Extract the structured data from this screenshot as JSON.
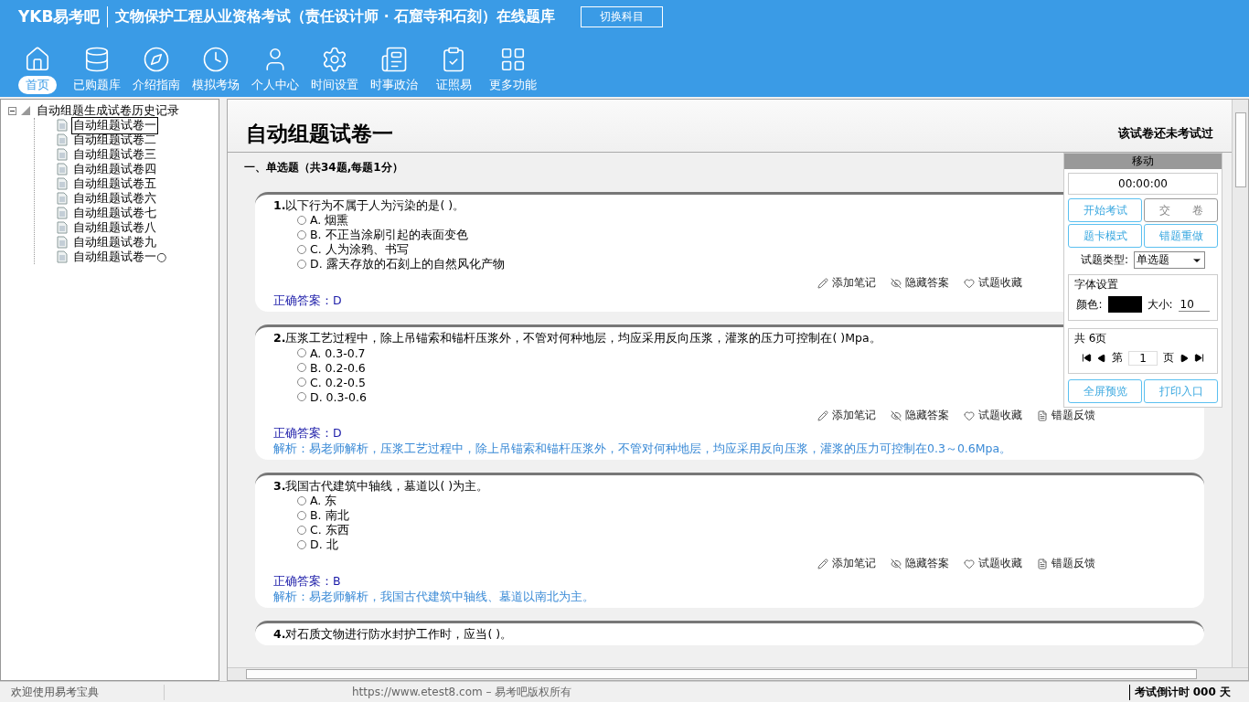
{
  "header": {
    "logo": "YKB易考吧",
    "title": "文物保护工程从业资格考试（责任设计师 · 石窟寺和石刻）在线题库",
    "switch_button": "切换科目"
  },
  "nav": [
    {
      "label": "首页",
      "selected": true,
      "kind": "home"
    },
    {
      "label": "已购题库",
      "selected": false,
      "kind": "bank"
    },
    {
      "label": "介绍指南",
      "selected": false,
      "kind": "guide"
    },
    {
      "label": "模拟考场",
      "selected": false,
      "kind": "exam"
    },
    {
      "label": "个人中心",
      "selected": false,
      "kind": "user"
    },
    {
      "label": "时间设置",
      "selected": false,
      "kind": "settings"
    },
    {
      "label": "时事政治",
      "selected": false,
      "kind": "news"
    },
    {
      "label": "证照易",
      "selected": false,
      "kind": "cert"
    },
    {
      "label": "更多功能",
      "selected": false,
      "kind": "more"
    }
  ],
  "tree": {
    "label": "自动组题生成试卷历史记录",
    "expanded": true,
    "children": [
      {
        "label": "自动组题试卷一",
        "selected": true
      },
      {
        "label": "自动组题试卷二",
        "selected": false
      },
      {
        "label": "自动组题试卷三",
        "selected": false
      },
      {
        "label": "自动组题试卷四",
        "selected": false
      },
      {
        "label": "自动组题试卷五",
        "selected": false
      },
      {
        "label": "自动组题试卷六",
        "selected": false
      },
      {
        "label": "自动组题试卷七",
        "selected": false
      },
      {
        "label": "自动组题试卷八",
        "selected": false
      },
      {
        "label": "自动组题试卷九",
        "selected": false
      },
      {
        "label": "自动组题试卷一○",
        "selected": false
      }
    ]
  },
  "paper": {
    "title": "自动组题试卷一",
    "status": "该试卷还未考试过",
    "section": "一、单选题（共34题,每题1分）",
    "questions": [
      {
        "number": "1.",
        "text": "以下行为不属于人为污染的是( )。",
        "options": [
          {
            "letter": "A.",
            "text": "烟熏",
            "selected": false
          },
          {
            "letter": "B.",
            "text": "不正当涂刷引起的表面变色",
            "selected": false
          },
          {
            "letter": "C.",
            "text": "人为涂鸦、书写",
            "selected": false
          },
          {
            "letter": "D.",
            "text": "露天存放的石刻上的自然风化产物",
            "selected": false
          }
        ],
        "actions": [
          "添加笔记",
          "隐藏答案",
          "试题收藏"
        ],
        "answer_label": "正确答案：",
        "answer": "D"
      },
      {
        "number": "2.",
        "text": "压浆工艺过程中，除上吊锚索和锚杆压浆外，不管对何种地层，均应采用反向压浆，灌浆的压力可控制在( )Mpa。",
        "options": [
          {
            "letter": "A.",
            "text": "0.3-0.7",
            "selected": false
          },
          {
            "letter": "B.",
            "text": "0.2-0.6",
            "selected": false
          },
          {
            "letter": "C.",
            "text": "0.2-0.5",
            "selected": false
          },
          {
            "letter": "D.",
            "text": "0.3-0.6",
            "selected": false
          }
        ],
        "actions": [
          "添加笔记",
          "隐藏答案",
          "试题收藏",
          "错题反馈"
        ],
        "answer_label": "正确答案：",
        "answer": "D",
        "analysis": "解析：易老师解析，压浆工艺过程中，除上吊锚索和锚杆压浆外，不管对何种地层，均应采用反向压浆，灌浆的压力可控制在0.3～0.6Mpa。"
      },
      {
        "number": "3.",
        "text": "我国古代建筑中轴线，墓道以( )为主。",
        "options": [
          {
            "letter": "A.",
            "text": "东",
            "selected": false
          },
          {
            "letter": "B.",
            "text": "南北",
            "selected": false
          },
          {
            "letter": "C.",
            "text": "东西",
            "selected": false
          },
          {
            "letter": "D.",
            "text": "北",
            "selected": false
          }
        ],
        "actions": [
          "添加笔记",
          "隐藏答案",
          "试题收藏",
          "错题反馈"
        ],
        "answer_label": "正确答案：",
        "answer": "B",
        "analysis": "解析：易老师解析，我国古代建筑中轴线、墓道以南北为主。"
      },
      {
        "number": "4.",
        "text": "对石质文物进行防水封护工作时，应当( )。"
      }
    ]
  },
  "panel": {
    "header": "移动",
    "timer": "00:00:00",
    "buttons": [
      {
        "label": "开始考试",
        "disabled": false
      },
      {
        "label": "交　　卷",
        "disabled": true
      },
      {
        "label": "题卡模式",
        "disabled": false
      },
      {
        "label": "错题重做",
        "disabled": false
      }
    ],
    "type_label": "试题类型:",
    "type_value": "单选题",
    "font_legend": "字体设置",
    "color_label": "颜色:",
    "color": "#000000",
    "size_label": "大小:",
    "size_value": "10",
    "pages_legend": "共 6页",
    "page_prefix": "第",
    "page_value": "1",
    "page_suffix": "页",
    "bottom_buttons": [
      "全屏预览",
      "打印入口"
    ]
  },
  "status_bar": {
    "left": "欢迎使用易考宝典",
    "center": "https://www.etest8.com – 易考吧版权所有",
    "right": "考试倒计时 000 天"
  }
}
